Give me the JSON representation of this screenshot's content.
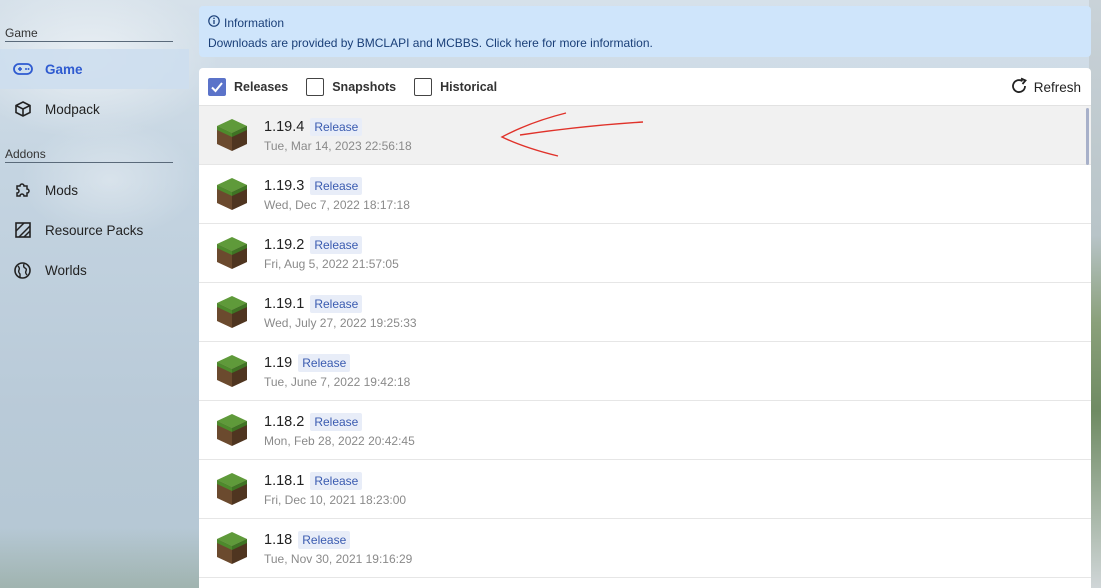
{
  "sidebar": {
    "sections": [
      {
        "label": "Game"
      },
      {
        "label": "Addons"
      }
    ],
    "items": [
      {
        "label": "Game",
        "icon": "gamepad-icon",
        "active": true
      },
      {
        "label": "Modpack",
        "icon": "box-icon",
        "active": false
      },
      {
        "label": "Mods",
        "icon": "puzzle-icon",
        "active": false
      },
      {
        "label": "Resource Packs",
        "icon": "texture-icon",
        "active": false
      },
      {
        "label": "Worlds",
        "icon": "globe-icon",
        "active": false
      }
    ]
  },
  "info": {
    "title": "Information",
    "body": "Downloads are provided by BMCLAPI and MCBBS. Click here for more information.",
    "icon": "info-icon"
  },
  "toolbar": {
    "filters": [
      {
        "label": "Releases",
        "checked": true
      },
      {
        "label": "Snapshots",
        "checked": false
      },
      {
        "label": "Historical",
        "checked": false
      }
    ],
    "refresh_label": "Refresh"
  },
  "versions": [
    {
      "version": "1.19.4",
      "tag": "Release",
      "date": "Tue, Mar 14, 2023 22:56:18",
      "selected": true
    },
    {
      "version": "1.19.3",
      "tag": "Release",
      "date": "Wed, Dec 7, 2022 18:17:18",
      "selected": false
    },
    {
      "version": "1.19.2",
      "tag": "Release",
      "date": "Fri, Aug 5, 2022 21:57:05",
      "selected": false
    },
    {
      "version": "1.19.1",
      "tag": "Release",
      "date": "Wed, July 27, 2022 19:25:33",
      "selected": false
    },
    {
      "version": "1.19",
      "tag": "Release",
      "date": "Tue, June 7, 2022 19:42:18",
      "selected": false
    },
    {
      "version": "1.18.2",
      "tag": "Release",
      "date": "Mon, Feb 28, 2022 20:42:45",
      "selected": false
    },
    {
      "version": "1.18.1",
      "tag": "Release",
      "date": "Fri, Dec 10, 2021 18:23:00",
      "selected": false
    },
    {
      "version": "1.18",
      "tag": "Release",
      "date": "Tue, Nov 30, 2021 19:16:29",
      "selected": false
    }
  ],
  "colors": {
    "accent": "#2f5bd0",
    "checkbox_checked": "#5b73c9",
    "info_bg": "#cfe5fb",
    "annotation": "#e0322a"
  }
}
